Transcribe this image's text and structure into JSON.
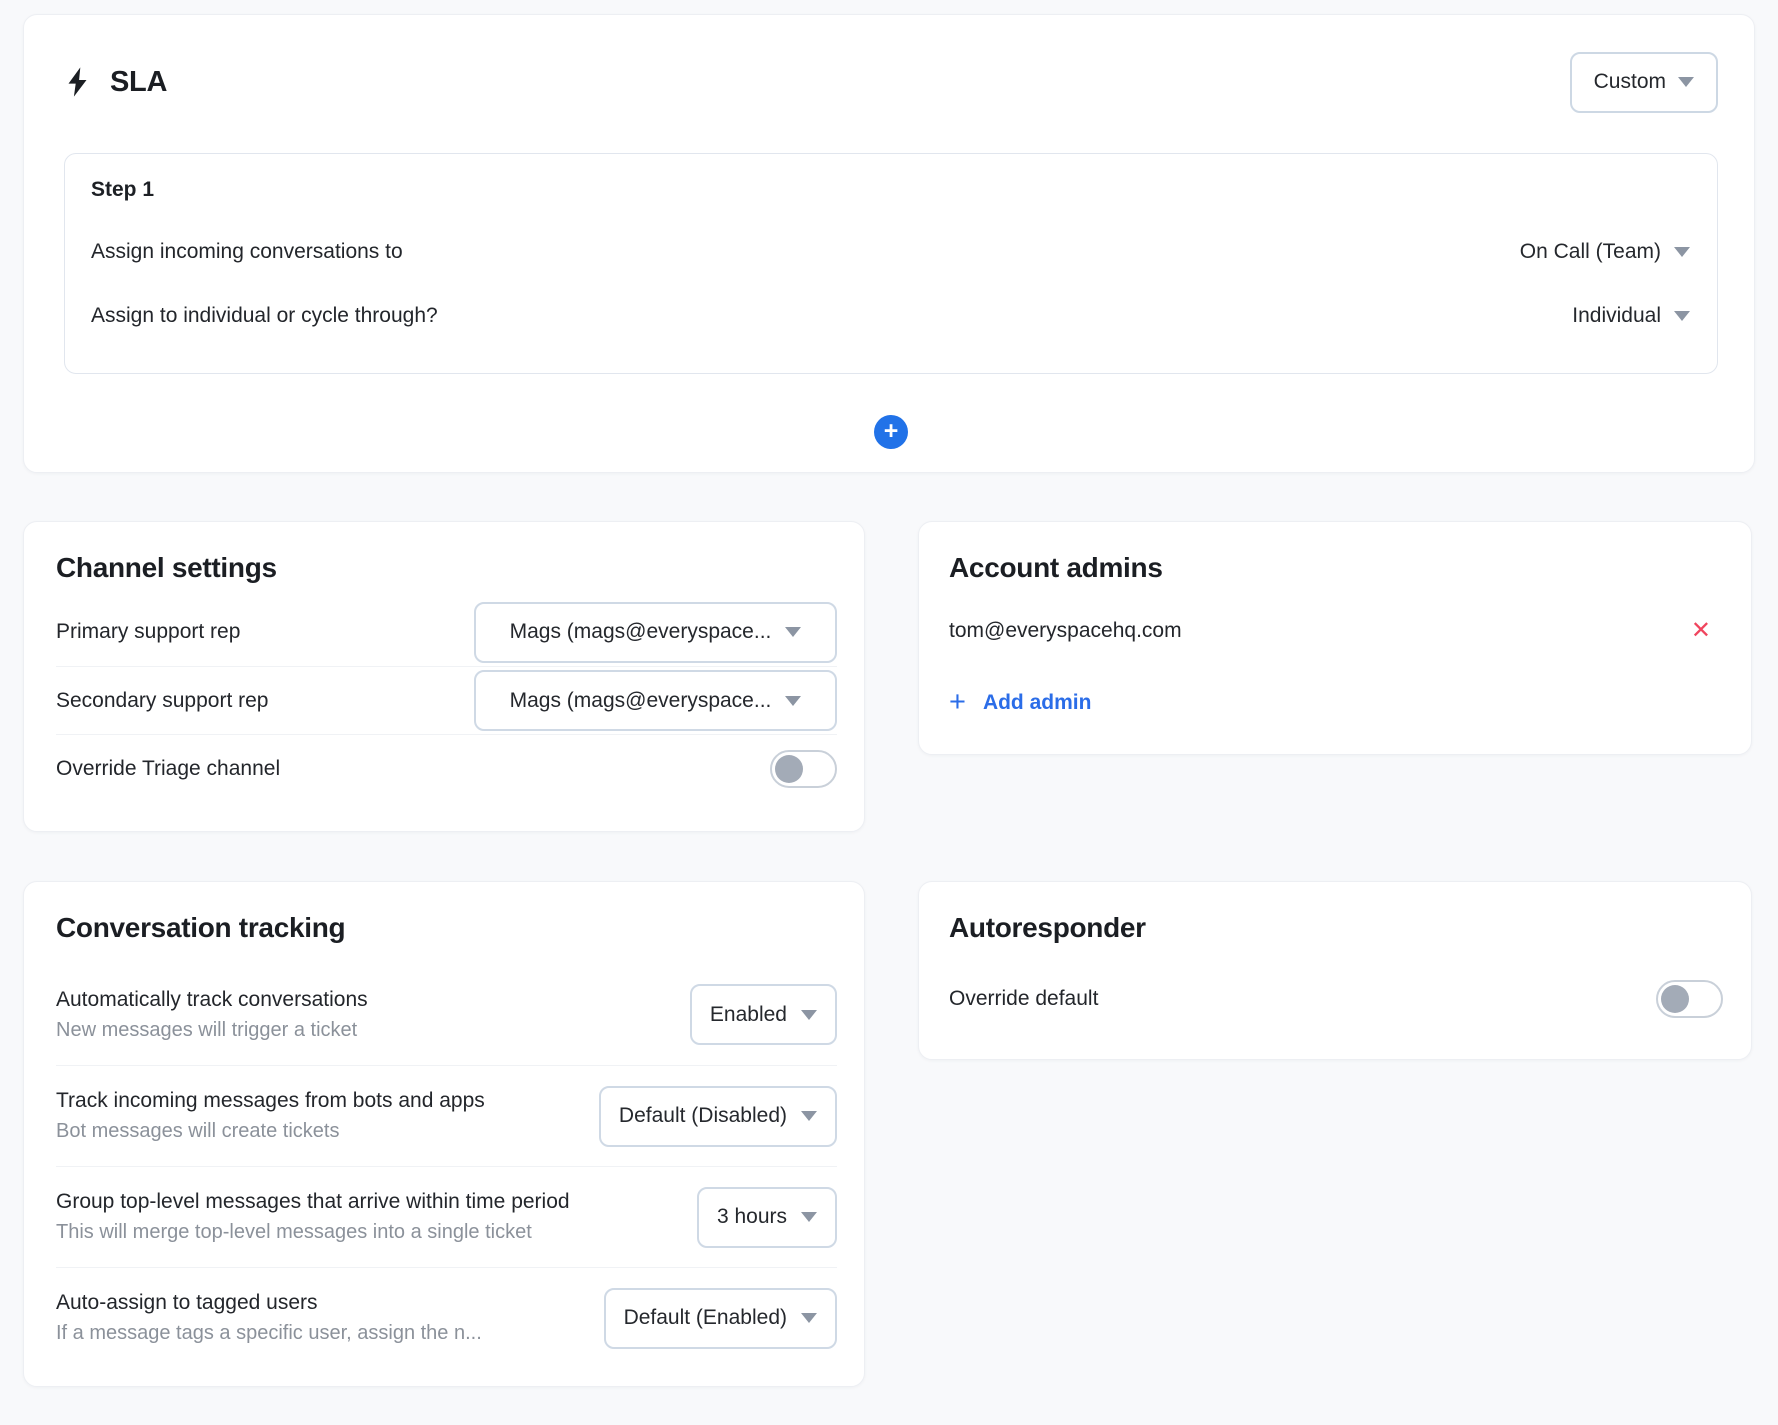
{
  "icons": {
    "plus": "+",
    "close": "✕"
  },
  "sla": {
    "title": "SLA",
    "preset": "Custom",
    "step": {
      "title": "Step 1",
      "rows": [
        {
          "label": "Assign incoming conversations to",
          "value": "On Call (Team)"
        },
        {
          "label": "Assign to individual or cycle through?",
          "value": "Individual"
        }
      ]
    }
  },
  "channel_settings": {
    "title": "Channel settings",
    "rows": [
      {
        "label": "Primary support rep",
        "value": "Mags (mags@everyspace..."
      },
      {
        "label": "Secondary support rep",
        "value": "Mags (mags@everyspace..."
      },
      {
        "label": "Override Triage channel",
        "toggle_state": "off"
      }
    ]
  },
  "account_admins": {
    "title": "Account admins",
    "admins": [
      {
        "email": "tom@everyspacehq.com"
      }
    ],
    "add_label": "Add admin"
  },
  "conversation_tracking": {
    "title": "Conversation tracking",
    "rows": [
      {
        "label": "Automatically track conversations",
        "description": "New messages will trigger a ticket",
        "value": "Enabled"
      },
      {
        "label": "Track incoming messages from bots and apps",
        "description": "Bot messages will create tickets",
        "value": "Default (Disabled)"
      },
      {
        "label": "Group top-level messages that arrive within time period",
        "description": "This will merge top-level messages into a single ticket",
        "value": "3 hours"
      },
      {
        "label": "Auto-assign to tagged users",
        "description": "If a message tags a specific user, assign the n...",
        "value": "Default (Enabled)"
      }
    ]
  },
  "autoresponder": {
    "title": "Autoresponder",
    "rows": [
      {
        "label": "Override default",
        "toggle_state": "off"
      }
    ]
  },
  "colors": {
    "accent_blue": "#2172e8",
    "link_blue": "#2b6de8",
    "danger_red": "#f0455e",
    "background": "#f8f9fb"
  }
}
